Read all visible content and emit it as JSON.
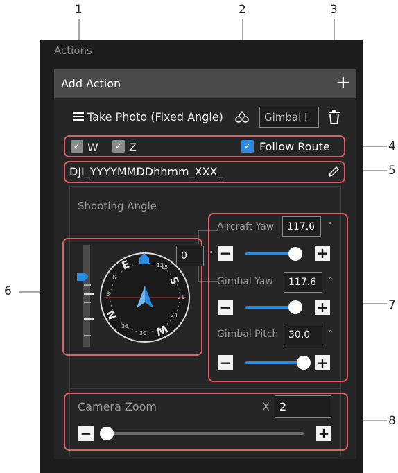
{
  "callouts": {
    "c1": "1",
    "c2": "2",
    "c3": "3",
    "c4": "4",
    "c5": "5",
    "c6": "6",
    "c7": "7",
    "c8": "8"
  },
  "panel": {
    "title": "Actions",
    "add_action_label": "Add Action"
  },
  "action": {
    "name": "Take Photo (Fixed Angle)",
    "gimbal_field": "Gimbal I"
  },
  "options": {
    "w_label": "W",
    "z_label": "Z",
    "follow_route_label": "Follow Route",
    "w_checked": true,
    "z_checked": true,
    "follow_route_checked": true
  },
  "filename": {
    "value": "DJI_YYYYMMDDhhmm_XXX_"
  },
  "shooting": {
    "title": "Shooting Angle",
    "compass_heading_value": "0",
    "compass_letters": [
      "N",
      "E",
      "S",
      "W"
    ],
    "compass_numbers": [
      "3",
      "6",
      "12",
      "15",
      "21",
      "24",
      "30",
      "33"
    ],
    "aircraft_yaw_label": "Aircraft Yaw",
    "aircraft_yaw_value": "117.6",
    "gimbal_yaw_label": "Gimbal Yaw",
    "gimbal_yaw_value": "117.6",
    "gimbal_pitch_label": "Gimbal Pitch",
    "gimbal_pitch_value": "30.0",
    "degree_symbol": "°"
  },
  "zoom": {
    "title": "Camera Zoom",
    "x_label": "X",
    "value": "2"
  },
  "colors": {
    "accent": "#2a8be0",
    "callout_border": "#e0606a",
    "panel_bg": "#1d1d1d"
  }
}
